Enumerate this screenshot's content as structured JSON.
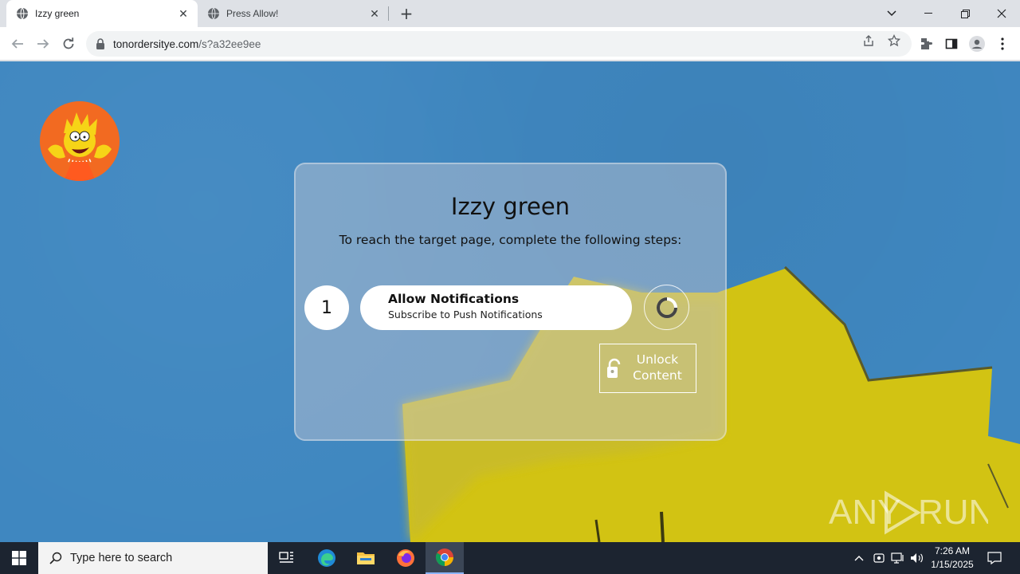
{
  "browser": {
    "tabs": [
      {
        "title": "Izzy green",
        "active": true
      },
      {
        "title": "Press Allow!",
        "active": false
      }
    ],
    "url_host": "tonordersitye.com",
    "url_path": "/s?a32ee9ee"
  },
  "card": {
    "title": "Izzy green",
    "subtitle": "To reach the target page, complete the following steps:",
    "step_number": "1",
    "step_title": "Allow Notifications",
    "step_desc": "Subscribe to Push Notifications",
    "unlock_line1": "Unlock",
    "unlock_line2": "Content"
  },
  "watermark": {
    "text_left": "ANY",
    "text_right": "RUN"
  },
  "taskbar": {
    "search_placeholder": "Type here to search",
    "time": "7:26 AM",
    "date": "1/15/2025"
  },
  "colors": {
    "page_bg": "#3f87c0",
    "hair_yellow": "#d4c212",
    "avatar_bg": "#f26a21"
  }
}
